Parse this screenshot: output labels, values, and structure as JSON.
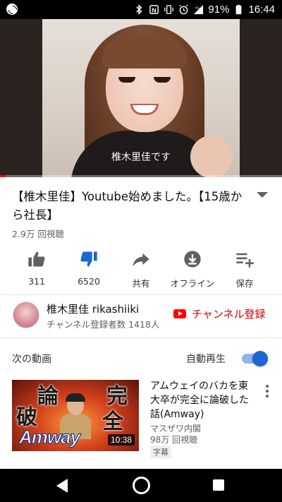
{
  "status_bar": {
    "battery": "91%",
    "time": "16:44",
    "network": "4G",
    "icons": [
      "baseball-icon",
      "bluetooth-icon",
      "nfc-icon",
      "vibrate-icon",
      "alarm-icon",
      "signal-icon",
      "battery-icon"
    ]
  },
  "player": {
    "caption": "椎木里佳です",
    "progress_fraction": 0.02,
    "progress_color": "#ff0000"
  },
  "video": {
    "title": "【椎木里佳】Youtube始めました。【15歳から社長】",
    "views": "2.9万 回視聴"
  },
  "actions": [
    {
      "label": "311",
      "icon": "thumbs-up-icon"
    },
    {
      "label": "6520",
      "icon": "thumbs-down-icon",
      "active": true
    },
    {
      "label": "共有",
      "icon": "share-icon"
    },
    {
      "label": "オフライン",
      "icon": "download-icon"
    },
    {
      "label": "保存",
      "icon": "add-to-playlist-icon"
    }
  ],
  "channel": {
    "name": "椎木里佳 rikashiiki",
    "subscribers": "チャンネル登録者数 1418人",
    "subscribe_label": "チャンネル登録"
  },
  "up_next": {
    "heading": "次の動画",
    "autoplay_label": "自動再生",
    "autoplay_on": true,
    "accent_color": "#1a66d2"
  },
  "next_video": {
    "title": "アムウェイのバカを東大卒が完全に論破した話(Amway)",
    "channel": "マスザワ内閣",
    "views": "98万 回視聴",
    "badge": "字幕",
    "duration": "10:38",
    "thumb_text": {
      "left_top": "論",
      "left_bottom": "破",
      "right_top": "完",
      "right_bottom": "全",
      "logo": "Amway"
    }
  },
  "nav_bar": {
    "icons": [
      "back-icon",
      "home-icon",
      "recents-icon"
    ]
  }
}
